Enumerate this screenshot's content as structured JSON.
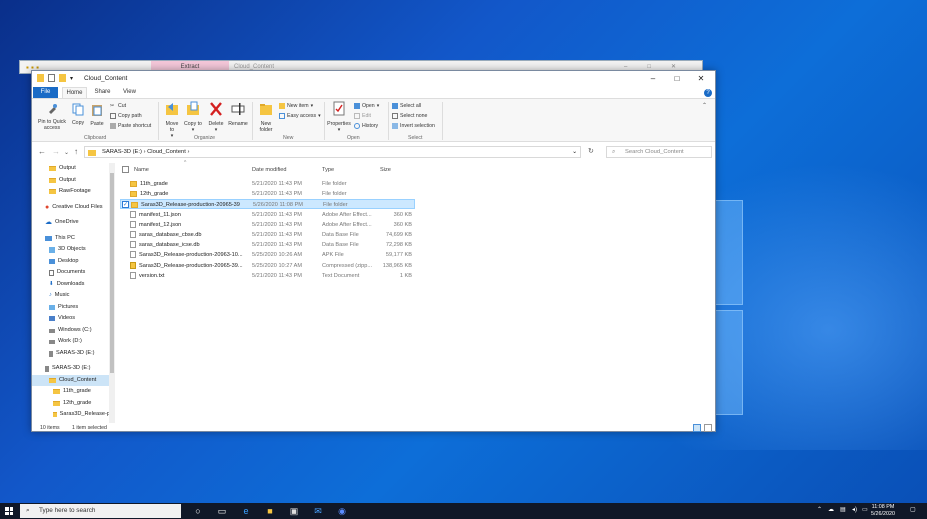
{
  "background_window": {
    "tab_extract": "Extract",
    "title": "Cloud_Content"
  },
  "window": {
    "title": "Cloud_Content"
  },
  "tabs": [
    "File",
    "Home",
    "Share",
    "View"
  ],
  "ribbon": {
    "pin": "Pin to Quick access",
    "copy": "Copy",
    "paste": "Paste",
    "cut": "Cut",
    "copy_path": "Copy path",
    "paste_shortcut": "Paste shortcut",
    "clipboard": "Clipboard",
    "move_to": "Move to",
    "copy_to": "Copy to",
    "delete": "Delete",
    "rename": "Rename",
    "organize": "Organize",
    "new_folder": "New folder",
    "new_item": "New item",
    "easy_access": "Easy access",
    "new": "New",
    "properties": "Properties",
    "open": "Open",
    "edit": "Edit",
    "history": "History",
    "open_group": "Open",
    "select_all": "Select all",
    "select_none": "Select none",
    "invert_selection": "Invert selection",
    "select": "Select"
  },
  "address": {
    "path_root": "SARAS-3D (E:)",
    "path_folder": "Cloud_Content",
    "search_placeholder": "Search Cloud_Content"
  },
  "sidebar": [
    "Output",
    "Output",
    "RawFootage",
    "Creative Cloud Files",
    "OneDrive",
    "This PC",
    "3D Objects",
    "Desktop",
    "Documents",
    "Downloads",
    "Music",
    "Pictures",
    "Videos",
    "Windows (C:)",
    "Work (D:)",
    "SARAS-3D (E:)",
    "SARAS-3D (E:)",
    "Cloud_Content",
    "11th_grade",
    "12th_grade",
    "Saras3D_Release-p"
  ],
  "columns": {
    "name": "Name",
    "date": "Date modified",
    "type": "Type",
    "size": "Size"
  },
  "files": [
    {
      "name": "11th_grade",
      "date": "5/21/2020 11:43 PM",
      "type": "File folder",
      "size": "",
      "icon": "folder"
    },
    {
      "name": "12th_grade",
      "date": "5/21/2020 11:43 PM",
      "type": "File folder",
      "size": "",
      "icon": "folder"
    },
    {
      "name": "Saras3D_Release-production-20965-39",
      "date": "5/26/2020 11:08 PM",
      "type": "File folder",
      "size": "",
      "icon": "folder"
    },
    {
      "name": "manifest_11.json",
      "date": "5/21/2020 11:43 PM",
      "type": "Adobe After Effect...",
      "size": "360 KB",
      "icon": "file"
    },
    {
      "name": "manifest_12.json",
      "date": "5/21/2020 11:43 PM",
      "type": "Adobe After Effect...",
      "size": "360 KB",
      "icon": "file"
    },
    {
      "name": "saras_database_cbse.db",
      "date": "5/21/2020 11:43 PM",
      "type": "Data Base File",
      "size": "74,699 KB",
      "icon": "file"
    },
    {
      "name": "saras_database_icse.db",
      "date": "5/21/2020 11:43 PM",
      "type": "Data Base File",
      "size": "72,298 KB",
      "icon": "file"
    },
    {
      "name": "Saras3D_Release-production-20963-10...",
      "date": "5/25/2020 10:26 AM",
      "type": "APK File",
      "size": "59,177 KB",
      "icon": "file"
    },
    {
      "name": "Saras3D_Release-production-20965-39...",
      "date": "5/25/2020 10:27 AM",
      "type": "Compressed (zipp...",
      "size": "138,965 KB",
      "icon": "zip"
    },
    {
      "name": "version.txt",
      "date": "5/21/2020 11:43 PM",
      "type": "Text Document",
      "size": "1 KB",
      "icon": "file"
    }
  ],
  "status": {
    "items": "10 items",
    "selected": "1 item selected"
  },
  "taskbar": {
    "search_placeholder": "Type here to search",
    "time": "11:08 PM",
    "date": "5/26/2020"
  }
}
